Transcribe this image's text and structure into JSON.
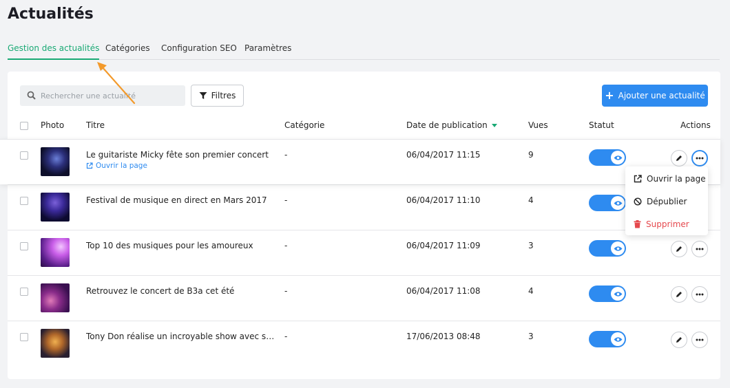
{
  "page": {
    "title": "Actualités"
  },
  "tabs": [
    {
      "label": "Gestion des actualités",
      "active": true
    },
    {
      "label": "Catégories"
    },
    {
      "label": "Configuration SEO"
    },
    {
      "label": "Paramètres"
    }
  ],
  "toolbar": {
    "search_placeholder": "Rechercher une actualité",
    "filter_label": "Filtres",
    "add_label": "Ajouter une actualité"
  },
  "table": {
    "headers": {
      "photo": "Photo",
      "title": "Titre",
      "category": "Catégorie",
      "date": "Date de publication",
      "views": "Vues",
      "status": "Statut",
      "actions": "Actions"
    },
    "rows": [
      {
        "title": "Le guitariste Micky fête son premier concert",
        "link": "Ouvrir la page",
        "category": "-",
        "date": "06/04/2017 11:15",
        "views": "9"
      },
      {
        "title": "Festival de musique en direct en Mars 2017",
        "category": "-",
        "date": "06/04/2017 11:10",
        "views": "4"
      },
      {
        "title": "Top 10 des musiques pour les amoureux",
        "category": "-",
        "date": "06/04/2017 11:09",
        "views": "3"
      },
      {
        "title": "Retrouvez le concert de B3a cet été",
        "category": "-",
        "date": "06/04/2017 11:08",
        "views": "4"
      },
      {
        "title": "Tony Don réalise un incroyable show avec son gr...",
        "category": "-",
        "date": "17/06/2013 08:48",
        "views": "3"
      }
    ]
  },
  "menu": {
    "open": "Ouvrir la page",
    "unpublish": "Dépublier",
    "delete": "Supprimer"
  },
  "colors": {
    "accent_green": "#19a974",
    "primary_blue": "#2e8bf0",
    "danger_red": "#e5484d",
    "arrow_orange": "#f39a2b"
  }
}
